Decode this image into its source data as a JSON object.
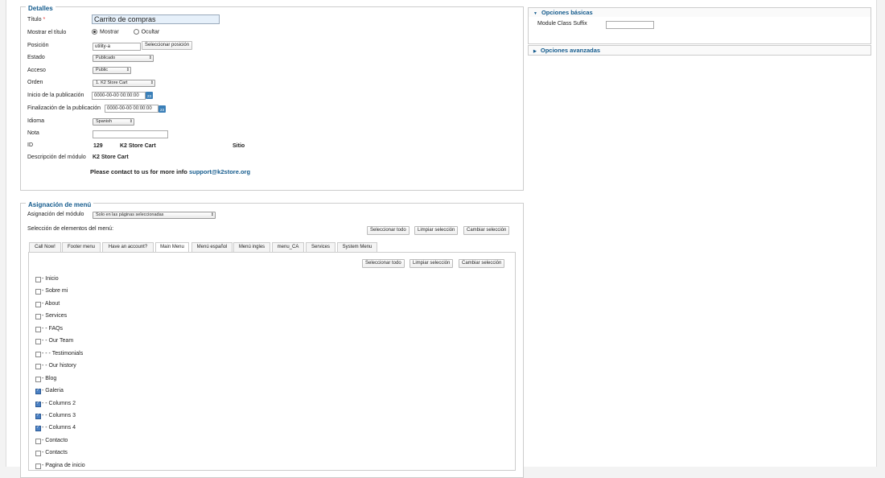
{
  "details": {
    "legend": "Detalles",
    "title_label": "Título",
    "required_mark": "*",
    "title_value": "Carrito de compras",
    "show_title_label": "Mostrar el título",
    "show_option": "Mostrar",
    "hide_option": "Ocultar",
    "position_label": "Posición",
    "position_value": "utility-a",
    "position_button": "Seleccionar posición",
    "state_label": "Estado",
    "state_value": "Publicado",
    "access_label": "Acceso",
    "access_value": "Public",
    "order_label": "Orden",
    "order_value": "1. K2 Store Cart",
    "publish_start_label": "Inicio de la publicación",
    "publish_start_value": "0000-00-00 00:00:00",
    "publish_end_label": "Finalización de la publicación",
    "publish_end_value": "0000-00-00 00:00:00",
    "calendar_day": "23",
    "language_label": "Idioma",
    "language_value": "Spanish",
    "note_label": "Nota",
    "note_value": "",
    "id_label": "ID",
    "id_value": "129",
    "module_name": "K2 Store Cart",
    "site_label": "Sitio",
    "module_desc_label": "Descripción del módulo",
    "module_desc_value": "K2 Store Cart",
    "contact_text": "Please contact to us for more info",
    "contact_email": "support@k2store.org"
  },
  "menu_assignment": {
    "legend": "Asignación de menú",
    "module_assign_label": "Asignación del módulo",
    "module_assign_value": "Solo en las páginas seleccionadas",
    "selection_label": "Selección de elementos del menú:",
    "select_all": "Seleccionar todo",
    "clear_selection": "Limpiar selección",
    "toggle_selection": "Cambiar selección",
    "tabs": [
      "Call Now!",
      "Footer menu",
      "Have an account?",
      "Main Menu",
      "Menú español",
      "Menú ingles",
      "menu_CA",
      "Services",
      "System Menu"
    ],
    "items": [
      {
        "label": "- Inicio",
        "checked": false
      },
      {
        "label": "- Sobre mi",
        "checked": false
      },
      {
        "label": "- About",
        "checked": false
      },
      {
        "label": "- Services",
        "checked": false
      },
      {
        "label": "- - FAQs",
        "checked": false
      },
      {
        "label": "- - Our Team",
        "checked": false
      },
      {
        "label": "- - - Testimonials",
        "checked": false
      },
      {
        "label": "- - Our history",
        "checked": false
      },
      {
        "label": "- Blog",
        "checked": false
      },
      {
        "label": "- Galeria",
        "checked": true
      },
      {
        "label": "- - Columns 2",
        "checked": true
      },
      {
        "label": "- - Columns 3",
        "checked": true
      },
      {
        "label": "- - Columns 4",
        "checked": true
      },
      {
        "label": "- Contacto",
        "checked": false
      },
      {
        "label": "- Contacts",
        "checked": false
      },
      {
        "label": "- Pagina de inicio",
        "checked": false
      }
    ]
  },
  "right_panel": {
    "basic_options": "Opciones básicas",
    "module_class_suffix_label": "Module Class Suffix",
    "module_class_suffix_value": "",
    "advanced_options": "Opciones avanzadas"
  }
}
